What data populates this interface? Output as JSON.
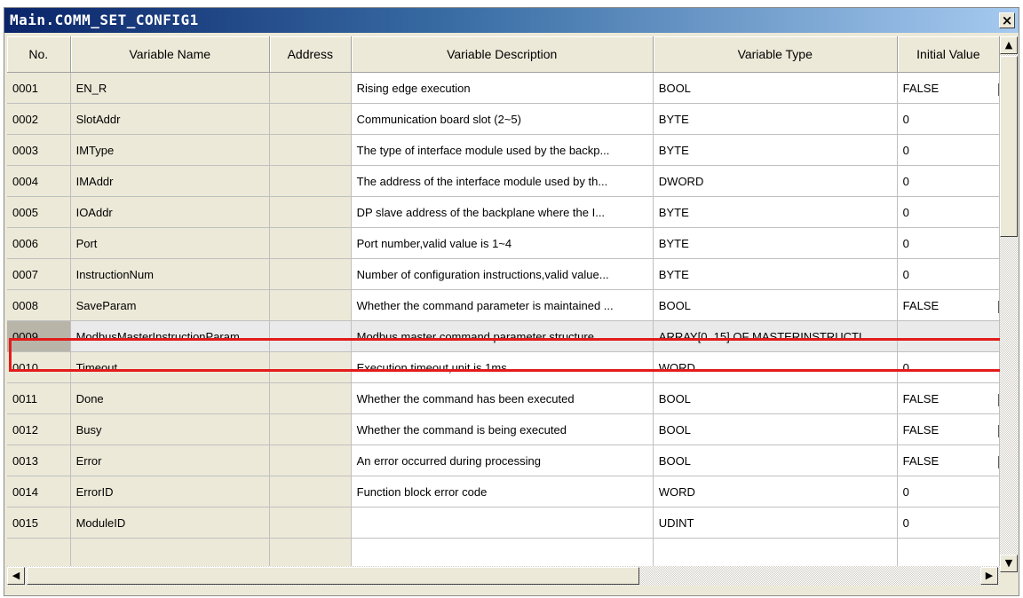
{
  "window": {
    "title": "Main.COMM_SET_CONFIG1",
    "close_glyph": "×"
  },
  "columns": [
    "No.",
    "Variable Name",
    "Address",
    "Variable Description",
    "Variable Type",
    "Initial Value"
  ],
  "rows": [
    {
      "no": "0001",
      "name": "EN_R",
      "address": "",
      "description": "Rising edge execution",
      "type": "BOOL",
      "initial": "FALSE"
    },
    {
      "no": "0002",
      "name": "SlotAddr",
      "address": "",
      "description": "Communication board slot (2~5)",
      "type": "BYTE",
      "initial": "0"
    },
    {
      "no": "0003",
      "name": "IMType",
      "address": "",
      "description": "The type of interface module used by the backp...",
      "type": "BYTE",
      "initial": "0"
    },
    {
      "no": "0004",
      "name": "IMAddr",
      "address": "",
      "description": "The address of the interface module used by th...",
      "type": "DWORD",
      "initial": "0"
    },
    {
      "no": "0005",
      "name": "IOAddr",
      "address": "",
      "description": "DP slave address of the backplane where the I...",
      "type": "BYTE",
      "initial": "0"
    },
    {
      "no": "0006",
      "name": "Port",
      "address": "",
      "description": "Port number,valid value is 1~4",
      "type": "BYTE",
      "initial": "0"
    },
    {
      "no": "0007",
      "name": "InstructionNum",
      "address": "",
      "description": "Number of configuration instructions,valid value...",
      "type": "BYTE",
      "initial": "0"
    },
    {
      "no": "0008",
      "name": "SaveParam",
      "address": "",
      "description": "Whether the command parameter is maintained ...",
      "type": "BOOL",
      "initial": "FALSE"
    },
    {
      "no": "0009",
      "name": "ModbusMasterInstructionParam",
      "address": "",
      "description": "Modbus master command parameter structure",
      "type": "ARRAY[0..15] OF MASTERINSTRUCTI...",
      "initial": "",
      "selected": true
    },
    {
      "no": "0010",
      "name": "Timeout",
      "address": "",
      "description": "Execution timeout,unit is 1ms",
      "type": "WORD",
      "initial": "0"
    },
    {
      "no": "0011",
      "name": "Done",
      "address": "",
      "description": "Whether the command has been executed",
      "type": "BOOL",
      "initial": "FALSE"
    },
    {
      "no": "0012",
      "name": "Busy",
      "address": "",
      "description": "Whether the command is being executed",
      "type": "BOOL",
      "initial": "FALSE"
    },
    {
      "no": "0013",
      "name": "Error",
      "address": "",
      "description": "An error occurred during processing",
      "type": "BOOL",
      "initial": "FALSE"
    },
    {
      "no": "0014",
      "name": "ErrorID",
      "address": "",
      "description": "Function block error code",
      "type": "WORD",
      "initial": "0"
    },
    {
      "no": "0015",
      "name": "ModuleID",
      "address": "",
      "description": "",
      "type": "UDINT",
      "initial": "0"
    }
  ],
  "scrollbar": {
    "up_glyph": "▲",
    "down_glyph": "▼",
    "left_glyph": "◀",
    "right_glyph": "▶"
  },
  "highlight_color": "#e31b1b"
}
